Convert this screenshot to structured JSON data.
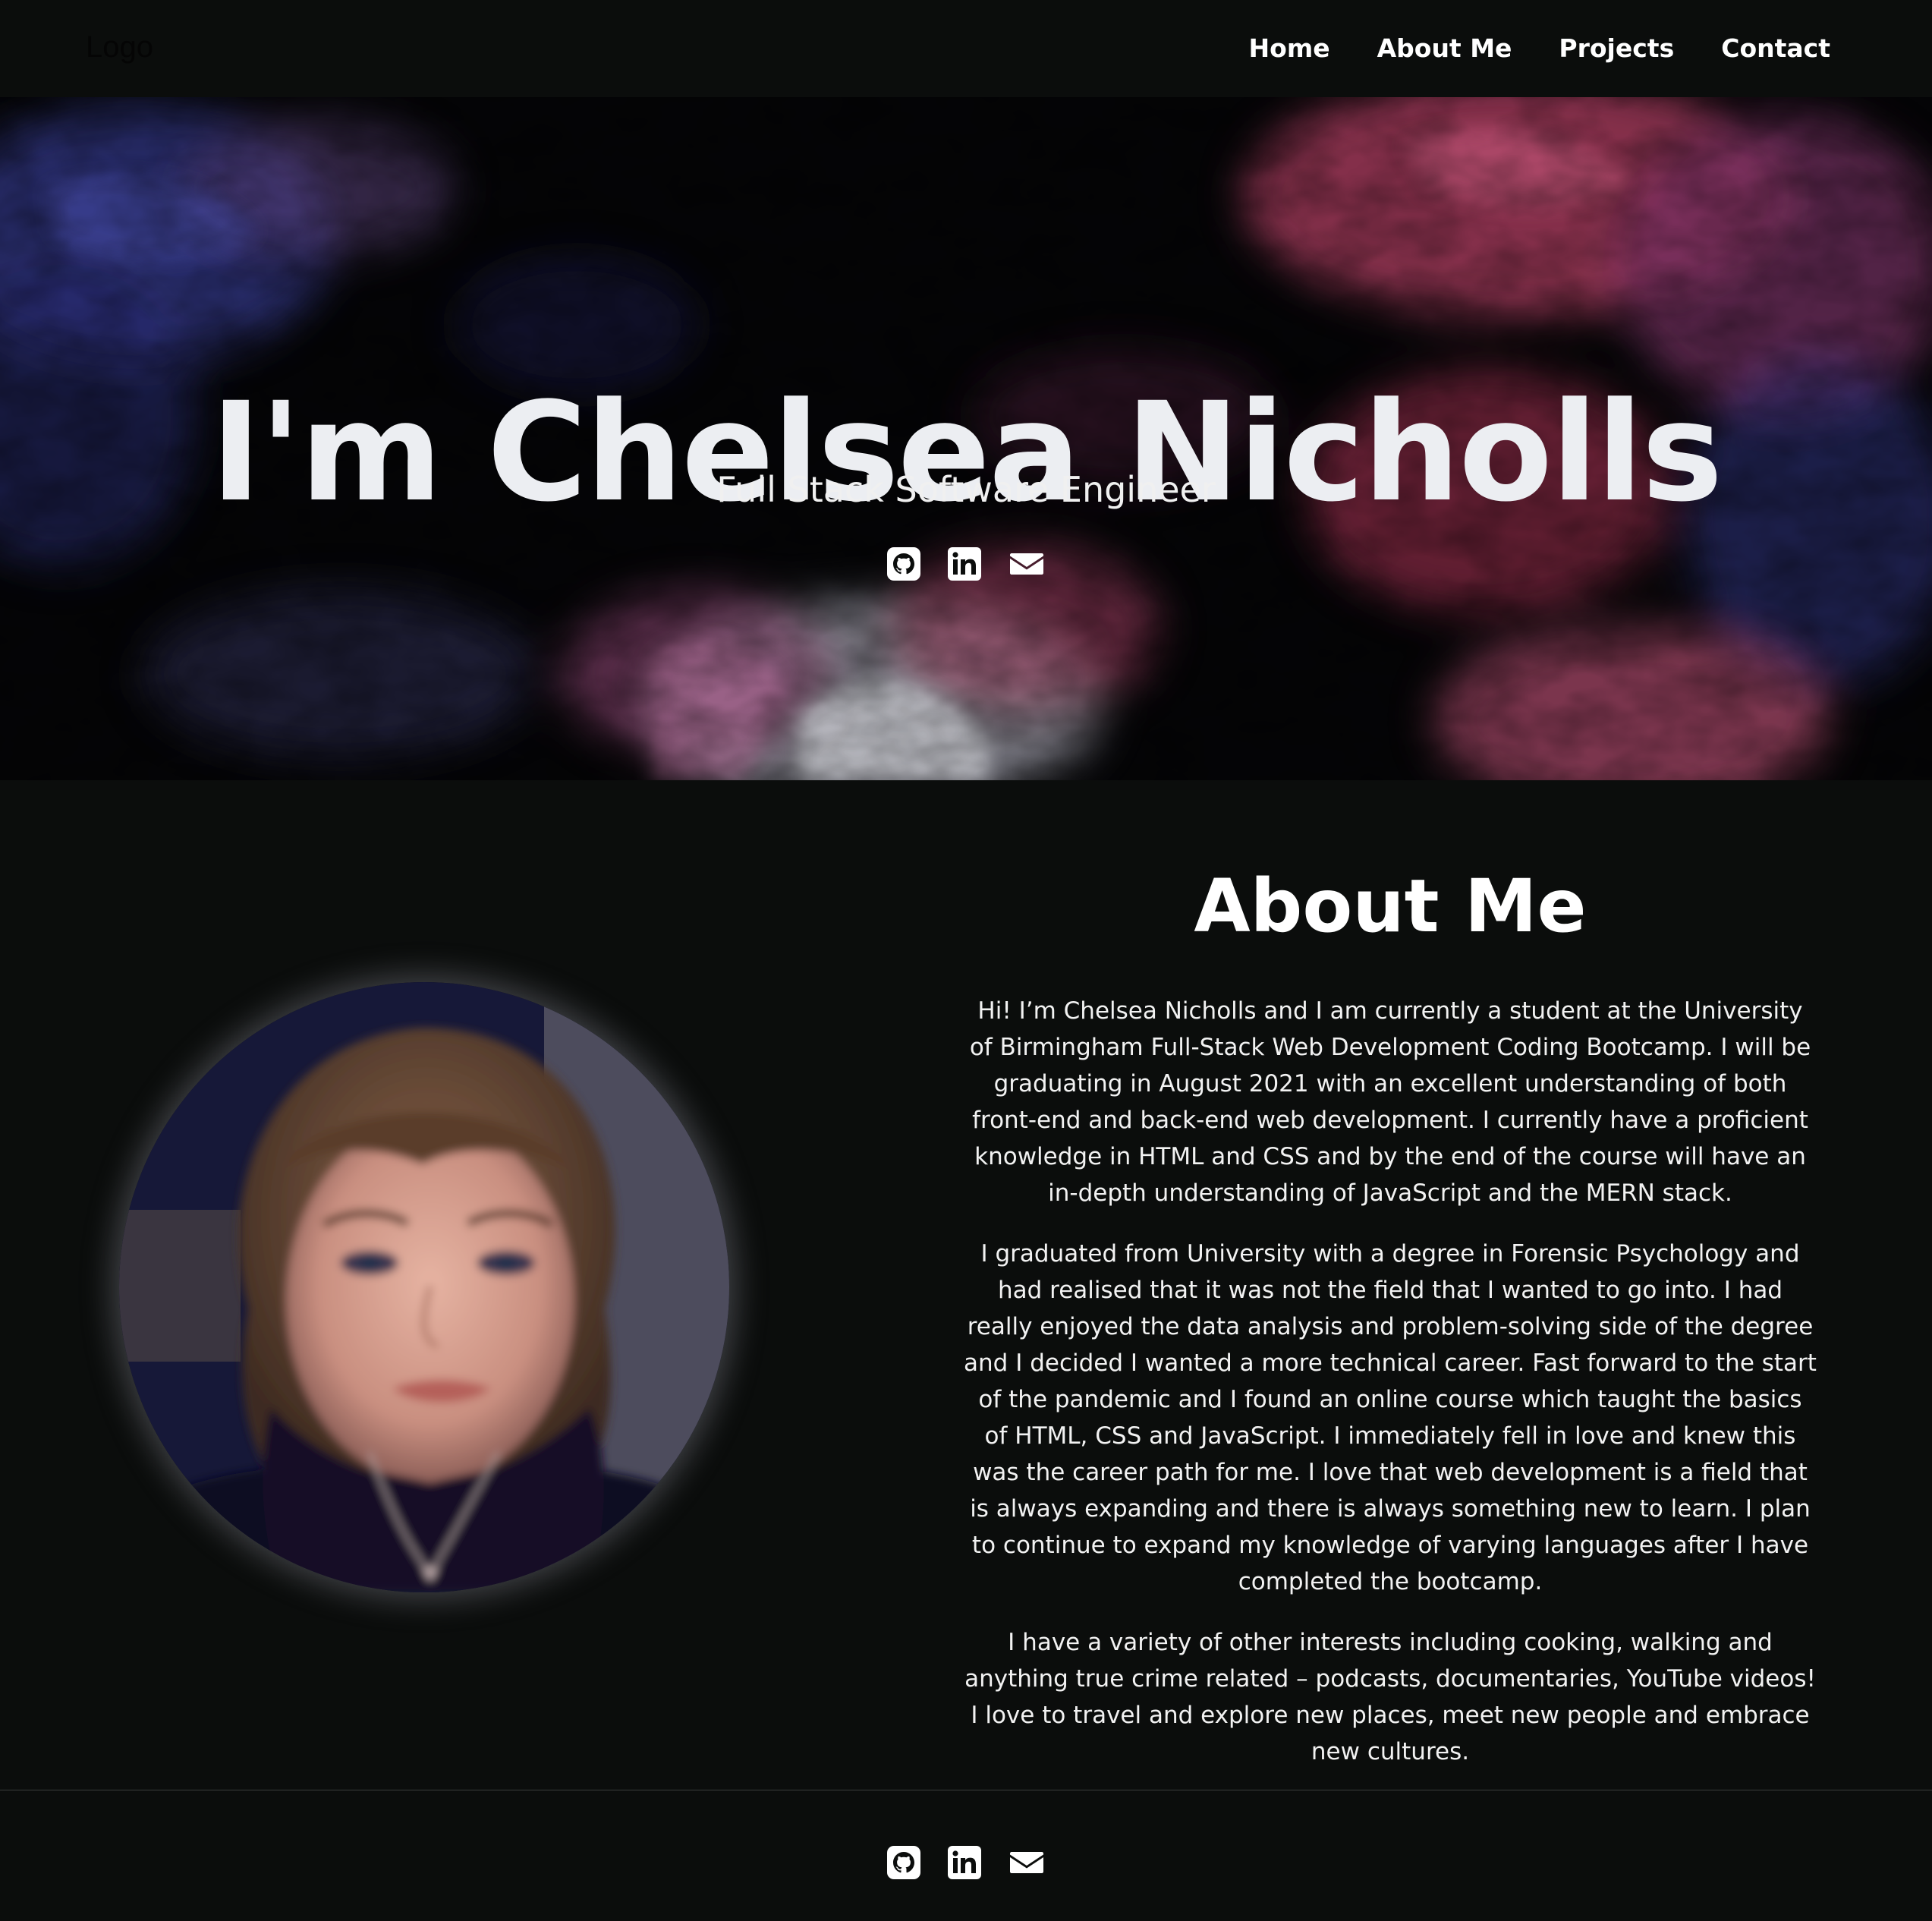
{
  "navbar": {
    "logo_text": "Logo",
    "links": [
      {
        "label": "Home"
      },
      {
        "label": "About Me"
      },
      {
        "label": "Projects"
      },
      {
        "label": "Contact"
      }
    ]
  },
  "hero": {
    "title": "I'm Chelsea Nicholls",
    "subtitle": "Full Stack Software Engineer",
    "icons": [
      "github-icon",
      "linkedin-icon",
      "email-icon"
    ]
  },
  "about": {
    "title": "About Me",
    "paragraphs": [
      "Hi! I’m Chelsea Nicholls and I am currently a student at the University of Birmingham Full-Stack Web Development Coding Bootcamp. I will be graduating in August 2021 with an excellent understanding of both front-end and back-end web development. I currently have a proficient knowledge in HTML and CSS and by the end of the course will have an in-depth understanding of JavaScript and the MERN stack.",
      "I graduated from University with a degree in Forensic Psychology and had realised that it was not the field that I wanted to go into. I had really enjoyed the data analysis and problem-solving side of the degree and I decided I wanted a more technical career. Fast forward to the start of the pandemic and I found an online course which taught the basics of HTML, CSS and JavaScript. I immediately fell in love and knew this was the career path for me. I love that web development is a field that is always expanding and there is always something new to learn. I plan to continue to expand my knowledge of varying languages after I have completed the bootcamp.",
      "I have a variety of other interests including cooking, walking and anything true crime related – podcasts, documentaries, YouTube videos! I love to travel and explore new places, meet new people and embrace new cultures."
    ]
  },
  "footer": {
    "icons": [
      "github-icon",
      "linkedin-icon",
      "email-icon"
    ]
  },
  "colors": {
    "background": "#0b0d0c",
    "text": "#ffffff",
    "accent_pink": "#d9507a",
    "accent_blue": "#3b3fa8"
  }
}
